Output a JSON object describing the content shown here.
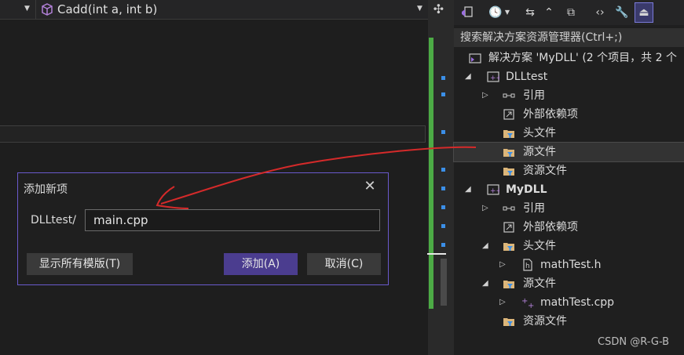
{
  "editor": {
    "nav_function": "Cadd(int a, int b)"
  },
  "solution_explorer": {
    "search_placeholder": "搜索解决方案资源管理器(Ctrl+;)",
    "tree": [
      {
        "label": "解决方案 'MyDLL' (2 个项目，共 2 个",
        "icon": "solution-icon"
      },
      {
        "label": "DLLtest",
        "icon": "cpp-project-icon"
      },
      {
        "label": "引用",
        "icon": "references-icon"
      },
      {
        "label": "外部依赖项",
        "icon": "external-deps-icon"
      },
      {
        "label": "头文件",
        "icon": "filter-folder-icon"
      },
      {
        "label": "源文件",
        "icon": "filter-folder-icon",
        "selected": true
      },
      {
        "label": "资源文件",
        "icon": "filter-folder-icon"
      },
      {
        "label": "MyDLL",
        "icon": "cpp-project-icon"
      },
      {
        "label": "引用",
        "icon": "references-icon"
      },
      {
        "label": "外部依赖项",
        "icon": "external-deps-icon"
      },
      {
        "label": "头文件",
        "icon": "filter-folder-icon"
      },
      {
        "label": "mathTest.h",
        "icon": "header-file-icon"
      },
      {
        "label": "源文件",
        "icon": "filter-folder-icon"
      },
      {
        "label": "mathTest.cpp",
        "icon": "cpp-file-icon"
      },
      {
        "label": "资源文件",
        "icon": "filter-folder-icon"
      }
    ]
  },
  "dialog": {
    "title": "添加新项",
    "path_label": "DLLtest/",
    "filename": "main.cpp",
    "show_templates_label": "显示所有模版(T)",
    "add_label": "添加(A)",
    "cancel_label": "取消(C)"
  },
  "watermark": "CSDN @R-G-B",
  "colors": {
    "accent": "#4b3d8f",
    "dialog_border": "#6a5acd",
    "change_bar": "#4cab45",
    "annotation_arrow": "#d42a2a"
  }
}
